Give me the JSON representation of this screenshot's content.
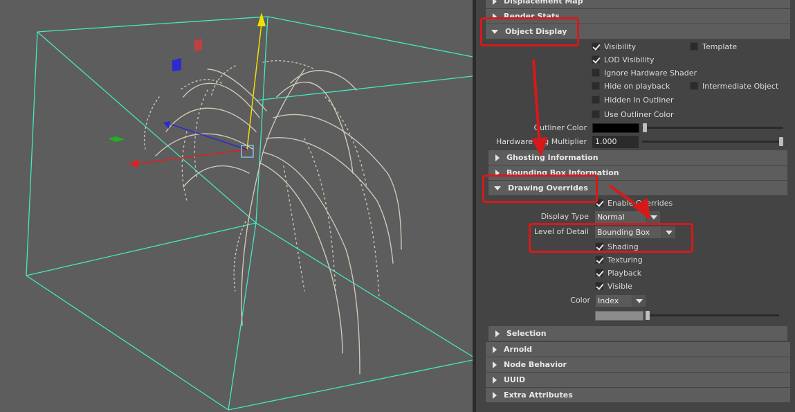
{
  "colors": {
    "accent_red": "#d8191a",
    "bbox_cyan": "#44e8c0",
    "viewport_bg": "#5d5d5d"
  },
  "viewport": {
    "name": "3d-viewport"
  },
  "sections_top": [
    {
      "label": "Displacement Map"
    },
    {
      "label": "Render Stats"
    },
    {
      "label": "Object Display"
    }
  ],
  "object_display": {
    "visibility": "Visibility",
    "template": "Template",
    "lod_visibility": "LOD Visibility",
    "ignore_hw_shader": "Ignore Hardware Shader",
    "hide_on_playback": "Hide on playback",
    "intermediate_object": "Intermediate Object",
    "hidden_in_outliner": "Hidden In Outliner",
    "use_outliner_color": "Use Outliner Color",
    "outliner_color_label": "Outliner Color",
    "hw_fog_label": "Hardware Fog Multiplier",
    "hw_fog_value": "1.000"
  },
  "sections_mid": [
    {
      "label": "Ghosting Information"
    },
    {
      "label": "Bounding Box Information"
    },
    {
      "label": "Drawing Overrides"
    }
  ],
  "drawing_overrides": {
    "enable_overrides": "Enable Overrides",
    "display_type_label": "Display Type",
    "display_type_value": "Normal",
    "lod_label": "Level of Detail",
    "lod_value": "Bounding Box",
    "shading": "Shading",
    "texturing": "Texturing",
    "playback": "Playback",
    "visible": "Visible",
    "color_label": "Color",
    "color_value": "Index"
  },
  "sections_bottom": [
    {
      "label": "Selection"
    },
    {
      "label": "Arnold"
    },
    {
      "label": "Node Behavior"
    },
    {
      "label": "UUID"
    },
    {
      "label": "Extra Attributes"
    }
  ]
}
